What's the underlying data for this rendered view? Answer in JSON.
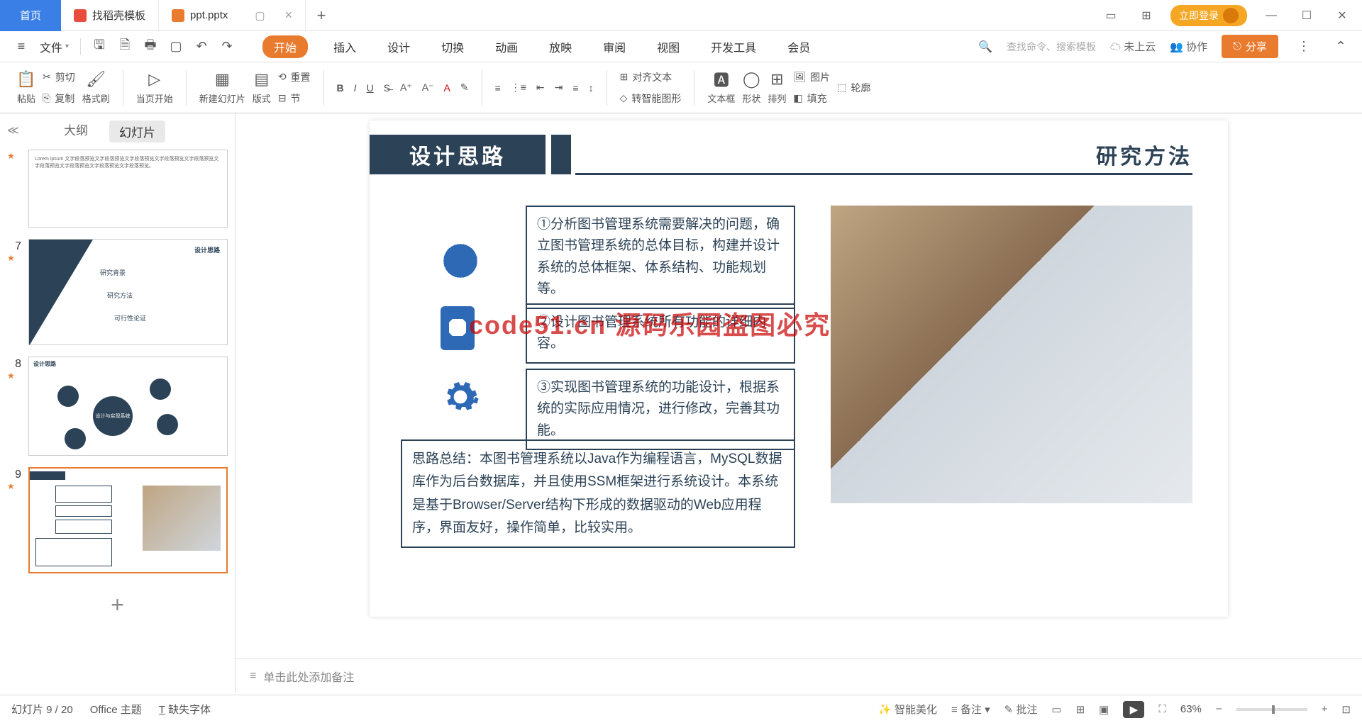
{
  "titlebar": {
    "home": "首页",
    "tab_template": "找稻壳模板",
    "tab_file": "ppt.pptx",
    "login": "立即登录"
  },
  "menubar": {
    "file": "文件",
    "tabs": [
      "开始",
      "插入",
      "设计",
      "切换",
      "动画",
      "放映",
      "审阅",
      "视图",
      "开发工具",
      "会员"
    ],
    "search_placeholder": "查找命令、搜索模板",
    "cloud": "未上云",
    "coop": "协作",
    "share": "分享"
  },
  "ribbon": {
    "paste": "粘贴",
    "cut": "剪切",
    "copy": "复制",
    "format_painter": "格式刷",
    "from_current": "当页开始",
    "new_slide": "新建幻灯片",
    "layout": "版式",
    "section": "节",
    "reset": "重置",
    "align_text": "对齐文本",
    "smart_shape": "转智能图形",
    "textbox": "文本框",
    "shape": "形状",
    "picture": "图片",
    "arrange": "排列",
    "fill": "填充",
    "outline": "轮廓"
  },
  "side": {
    "outline": "大纲",
    "slides": "幻灯片",
    "add": "+"
  },
  "thumbs": {
    "n7": "7",
    "n8": "8",
    "n9": "9",
    "t7_title": "设计思路",
    "t7_i1": "研究背景",
    "t7_i2": "研究方法",
    "t7_i3": "可行性论证",
    "t8_title": "设计思路",
    "t8_center": "设计与实现系统"
  },
  "slide": {
    "title": "设计思路",
    "right_title": "研究方法",
    "box1": "①分析图书管理系统需要解决的问题，确立图书管理系统的总体目标，构建并设计系统的总体框架、体系结构、功能规划等。",
    "box2": "②设计图书管理系统所有功能的详细内容。",
    "box3": "③实现图书管理系统的功能设计，根据系统的实际应用情况，进行修改，完善其功能。",
    "summary": "思路总结：本图书管理系统以Java作为编程语言，MySQL数据库作为后台数据库，并且使用SSM框架进行系统设计。本系统是基于Browser/Server结构下形成的数据驱动的Web应用程序，界面友好，操作简单，比较实用。",
    "watermark": "code51.cn  源码乐园盗图必究"
  },
  "notes": {
    "placeholder": "单击此处添加备注"
  },
  "status": {
    "slide_pos": "幻灯片 9 / 20",
    "theme": "Office 主题",
    "missing_font": "缺失字体",
    "beautify": "智能美化",
    "notes_btn": "备注",
    "comments": "批注",
    "zoom": "63%"
  }
}
